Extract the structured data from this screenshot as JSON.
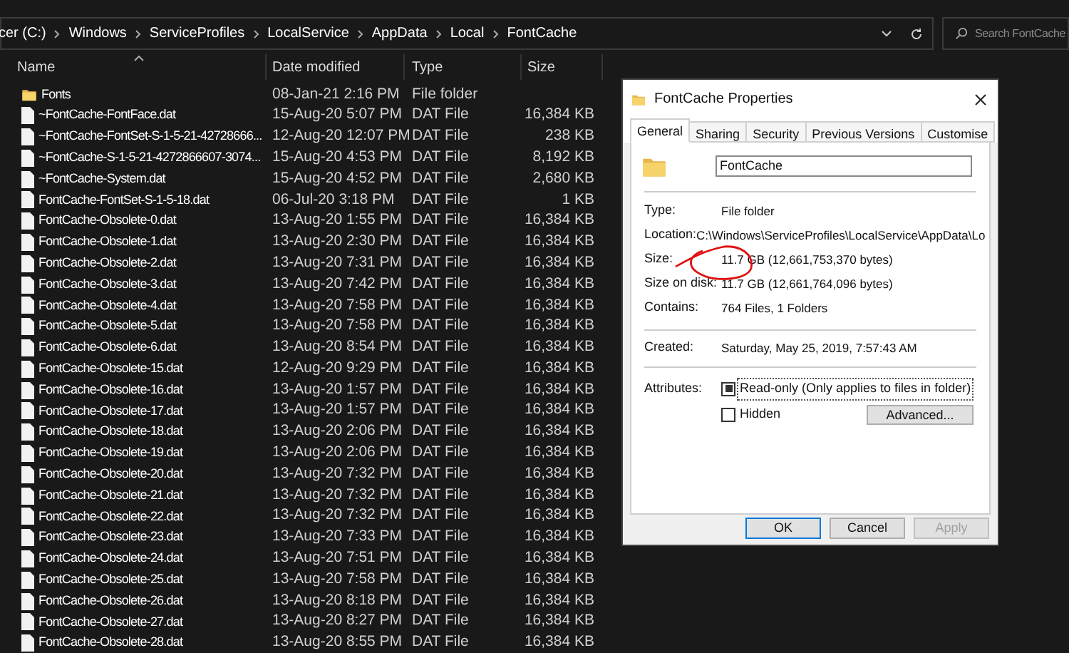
{
  "address_bar": {
    "segments": [
      "cer (C:)",
      "Windows",
      "ServiceProfiles",
      "LocalService",
      "AppData",
      "Local",
      "FontCache"
    ]
  },
  "search": {
    "placeholder": "Search FontCache"
  },
  "table": {
    "columns": [
      "Name",
      "Date modified",
      "Type",
      "Size"
    ],
    "rows": [
      {
        "kind": "folder",
        "name": "Fonts",
        "date": "08-Jan-21 2:16 PM",
        "type": "File folder",
        "size": ""
      },
      {
        "kind": "file",
        "name": "~FontCache-FontFace.dat",
        "date": "15-Aug-20 5:07 PM",
        "type": "DAT File",
        "size": "16,384 KB"
      },
      {
        "kind": "file",
        "name": "~FontCache-FontSet-S-1-5-21-42728666...",
        "date": "12-Aug-20 12:07 PM",
        "type": "DAT File",
        "size": "238 KB"
      },
      {
        "kind": "file",
        "name": "~FontCache-S-1-5-21-4272866607-3074...",
        "date": "15-Aug-20 4:53 PM",
        "type": "DAT File",
        "size": "8,192 KB"
      },
      {
        "kind": "file",
        "name": "~FontCache-System.dat",
        "date": "15-Aug-20 4:52 PM",
        "type": "DAT File",
        "size": "2,680 KB"
      },
      {
        "kind": "file",
        "name": "FontCache-FontSet-S-1-5-18.dat",
        "date": "06-Jul-20 3:18 PM",
        "type": "DAT File",
        "size": "1 KB"
      },
      {
        "kind": "file",
        "name": "FontCache-Obsolete-0.dat",
        "date": "13-Aug-20 1:55 PM",
        "type": "DAT File",
        "size": "16,384 KB"
      },
      {
        "kind": "file",
        "name": "FontCache-Obsolete-1.dat",
        "date": "13-Aug-20 2:30 PM",
        "type": "DAT File",
        "size": "16,384 KB"
      },
      {
        "kind": "file",
        "name": "FontCache-Obsolete-2.dat",
        "date": "13-Aug-20 7:31 PM",
        "type": "DAT File",
        "size": "16,384 KB"
      },
      {
        "kind": "file",
        "name": "FontCache-Obsolete-3.dat",
        "date": "13-Aug-20 7:42 PM",
        "type": "DAT File",
        "size": "16,384 KB"
      },
      {
        "kind": "file",
        "name": "FontCache-Obsolete-4.dat",
        "date": "13-Aug-20 7:58 PM",
        "type": "DAT File",
        "size": "16,384 KB"
      },
      {
        "kind": "file",
        "name": "FontCache-Obsolete-5.dat",
        "date": "13-Aug-20 7:58 PM",
        "type": "DAT File",
        "size": "16,384 KB"
      },
      {
        "kind": "file",
        "name": "FontCache-Obsolete-6.dat",
        "date": "13-Aug-20 8:54 PM",
        "type": "DAT File",
        "size": "16,384 KB"
      },
      {
        "kind": "file",
        "name": "FontCache-Obsolete-15.dat",
        "date": "12-Aug-20 9:29 PM",
        "type": "DAT File",
        "size": "16,384 KB"
      },
      {
        "kind": "file",
        "name": "FontCache-Obsolete-16.dat",
        "date": "13-Aug-20 1:57 PM",
        "type": "DAT File",
        "size": "16,384 KB"
      },
      {
        "kind": "file",
        "name": "FontCache-Obsolete-17.dat",
        "date": "13-Aug-20 1:57 PM",
        "type": "DAT File",
        "size": "16,384 KB"
      },
      {
        "kind": "file",
        "name": "FontCache-Obsolete-18.dat",
        "date": "13-Aug-20 2:06 PM",
        "type": "DAT File",
        "size": "16,384 KB"
      },
      {
        "kind": "file",
        "name": "FontCache-Obsolete-19.dat",
        "date": "13-Aug-20 2:06 PM",
        "type": "DAT File",
        "size": "16,384 KB"
      },
      {
        "kind": "file",
        "name": "FontCache-Obsolete-20.dat",
        "date": "13-Aug-20 7:32 PM",
        "type": "DAT File",
        "size": "16,384 KB"
      },
      {
        "kind": "file",
        "name": "FontCache-Obsolete-21.dat",
        "date": "13-Aug-20 7:32 PM",
        "type": "DAT File",
        "size": "16,384 KB"
      },
      {
        "kind": "file",
        "name": "FontCache-Obsolete-22.dat",
        "date": "13-Aug-20 7:32 PM",
        "type": "DAT File",
        "size": "16,384 KB"
      },
      {
        "kind": "file",
        "name": "FontCache-Obsolete-23.dat",
        "date": "13-Aug-20 7:33 PM",
        "type": "DAT File",
        "size": "16,384 KB"
      },
      {
        "kind": "file",
        "name": "FontCache-Obsolete-24.dat",
        "date": "13-Aug-20 7:51 PM",
        "type": "DAT File",
        "size": "16,384 KB"
      },
      {
        "kind": "file",
        "name": "FontCache-Obsolete-25.dat",
        "date": "13-Aug-20 7:58 PM",
        "type": "DAT File",
        "size": "16,384 KB"
      },
      {
        "kind": "file",
        "name": "FontCache-Obsolete-26.dat",
        "date": "13-Aug-20 8:18 PM",
        "type": "DAT File",
        "size": "16,384 KB"
      },
      {
        "kind": "file",
        "name": "FontCache-Obsolete-27.dat",
        "date": "13-Aug-20 8:27 PM",
        "type": "DAT File",
        "size": "16,384 KB"
      },
      {
        "kind": "file",
        "name": "FontCache-Obsolete-28.dat",
        "date": "13-Aug-20 8:55 PM",
        "type": "DAT File",
        "size": "16,384 KB"
      }
    ]
  },
  "dialog": {
    "title": "FontCache Properties",
    "tabs": [
      {
        "label": "General",
        "selected": true
      },
      {
        "label": "Sharing",
        "selected": false
      },
      {
        "label": "Security",
        "selected": false
      },
      {
        "label": "Previous Versions",
        "selected": false
      },
      {
        "label": "Customise",
        "selected": false
      }
    ],
    "name_field": {
      "value": "FontCache"
    },
    "groups": [
      [
        {
          "label": "Type:",
          "value": "File folder"
        },
        {
          "label": "Location:",
          "value": "C:\\Windows\\ServiceProfiles\\LocalService\\AppData\\Lo"
        },
        {
          "label": "Size:",
          "value": "11.7 GB (12,661,753,370 bytes)"
        },
        {
          "label": "Size on disk:",
          "value": "11.7 GB (12,661,764,096 bytes)"
        },
        {
          "label": "Contains:",
          "value": "764 Files, 1 Folders"
        }
      ],
      [
        {
          "label": "Created:",
          "value": "Saturday, May 25, 2019, 7:57:43 AM"
        }
      ]
    ],
    "attributes": {
      "label": "Attributes:",
      "checkboxes": [
        {
          "label": "Read-only (Only applies to files in folder)",
          "checked": true,
          "focused": true
        },
        {
          "label": "Hidden",
          "checked": false,
          "focused": false
        }
      ],
      "advanced_button": "Advanced..."
    },
    "buttons": [
      {
        "label": "OK",
        "default": true,
        "disabled": false
      },
      {
        "label": "Cancel",
        "default": false,
        "disabled": false
      },
      {
        "label": "Apply",
        "default": false,
        "disabled": true
      }
    ]
  }
}
